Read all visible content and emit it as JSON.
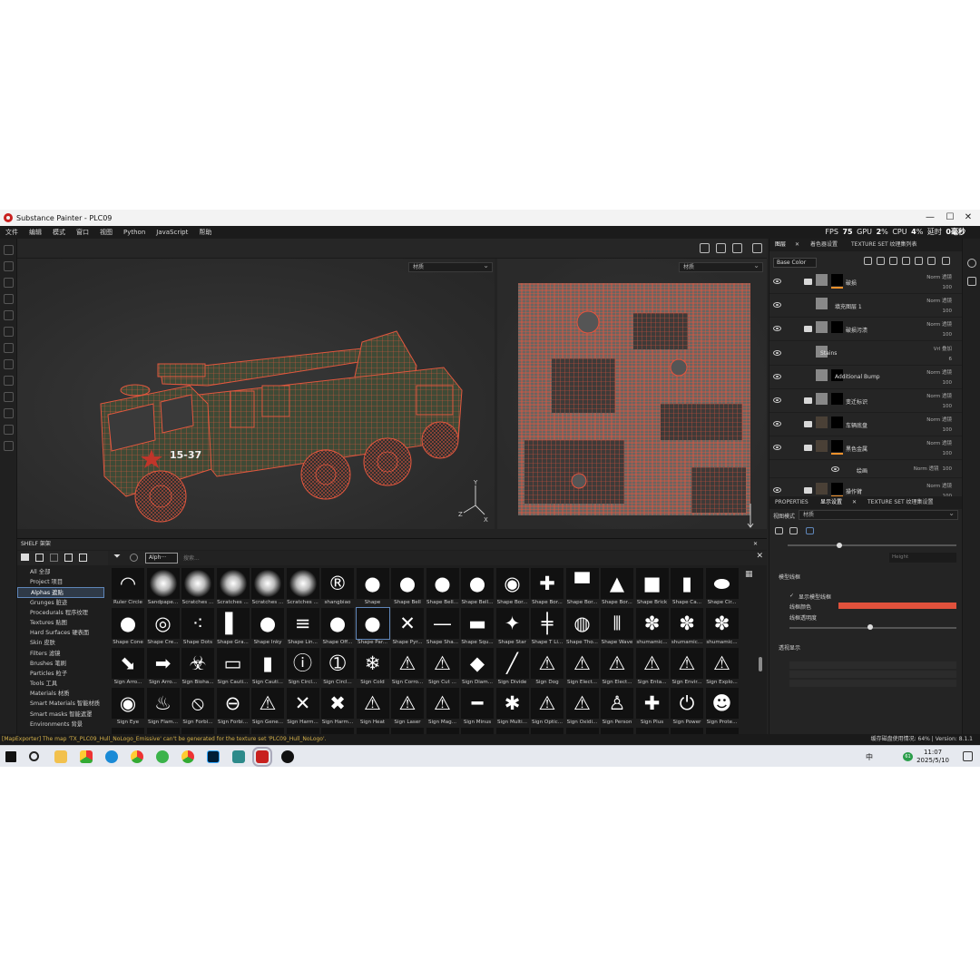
{
  "window": {
    "title": "Substance Painter - PLC09"
  },
  "menu": [
    "文件",
    "编辑",
    "模式",
    "窗口",
    "视图",
    "Python",
    "JavaScript",
    "帮助"
  ],
  "perf": {
    "fps_label": "FPS",
    "fps": "75",
    "gpu_label": "GPU",
    "gpu": "2",
    "cpu_label": "CPU",
    "cpu": "4",
    "latency_label": "延时",
    "latency": "0毫秒"
  },
  "viewport": {
    "mode_left": "材质",
    "mode_right": "材质",
    "unit_label": "15-37"
  },
  "shelf": {
    "title": "SHELF 架架",
    "search_chip": "Alph···",
    "search_placeholder": "搜索...",
    "categories": [
      "All 全部",
      "Project 项目",
      "Alphas 遮贴",
      "Grunges 脏迹",
      "Procedurals 程序纹理",
      "Textures 贴图",
      "Hard Surfaces 硬表面",
      "Skin 皮肤",
      "Filters 滤镜",
      "Brushes 笔刷",
      "Particles 粒子",
      "Tools 工具",
      "Materials 材质",
      "Smart Materials 智能材质",
      "Smart masks 智能遮罩",
      "Environments 背景"
    ],
    "selected_category": 2,
    "rows": [
      [
        "Ruler Circle",
        "Sandpape...",
        "Scratches ...",
        "Scratches ...",
        "Scratches ...",
        "Scratches ...",
        "shangbiao",
        "Shape",
        "Shape Bell",
        "Shape Bell...",
        "Shape Bell...",
        "Shape Bor...",
        "Shape Bor...",
        "Shape Bor...",
        "Shape Bor...",
        "Shape Brick",
        "Shape Ca...",
        "Shape Cir..."
      ],
      [
        "Shape Cone",
        "Shape Cre...",
        "Shape Dots",
        "Shape Gra...",
        "Shape Inky",
        "Shape Lin...",
        "Shape Off...",
        "Shape Par...",
        "Shape Pyr...",
        "Shape Sha...",
        "Shape Squ...",
        "Shape Star",
        "Shape T Li...",
        "Shape Tho...",
        "Shape Wave",
        "shumamic...",
        "shumamic...",
        "shumamic..."
      ],
      [
        "Sign Arro...",
        "Sign Arro...",
        "Sign Bioha...",
        "Sign Cauti...",
        "Sign Cauti...",
        "Sign Circl...",
        "Sign Circl...",
        "Sign Cold",
        "Sign Corro...",
        "Sign Cut ...",
        "Sign Diam...",
        "Sign Divide",
        "Sign Dog",
        "Sign Elect...",
        "Sign Elect...",
        "Sign Enta...",
        "Sign Envir...",
        "Sign Explo..."
      ],
      [
        "Sign Eye",
        "Sign Flam...",
        "Sign Forbi...",
        "Sign Forbi...",
        "Sign Gene...",
        "Sign Harm...",
        "Sign Harm...",
        "Sign Heat",
        "Sign Laser",
        "Sign Mag...",
        "Sign Minus",
        "Sign Multi...",
        "Sign Optic...",
        "Sign Oxidi...",
        "Sign Person",
        "Sign Plus",
        "Sign Power",
        "Sign Prote..."
      ],
      [
        "",
        "",
        "",
        "",
        "",
        "",
        "",
        "",
        "",
        "",
        "",
        "",
        "",
        "",
        "",
        "",
        "",
        ""
      ]
    ],
    "symbols": [
      [
        "◠",
        "",
        "",
        "",
        "",
        "",
        "®",
        "●",
        "●",
        "●",
        "●",
        "◉",
        "✚",
        "▀",
        "▲",
        "■",
        "▮",
        "⬬"
      ],
      [
        "●",
        "◎",
        "⁖",
        "▌",
        "●",
        "≡",
        "●",
        "●",
        "✕",
        "—",
        "▬",
        "✦",
        "╪",
        "◍",
        "⦀",
        "✽",
        "✽",
        "✽"
      ],
      [
        "⬊",
        "➡",
        "☣",
        "▭",
        "▮",
        "ⓘ",
        "➀",
        "❄",
        "⚠",
        "⚠",
        "◆",
        "╱",
        "⚠",
        "⚠",
        "⚠",
        "⚠",
        "⚠",
        "⚠"
      ],
      [
        "◉",
        "♨",
        "⦸",
        "⊖",
        "⚠",
        "✕",
        "✖",
        "⚠",
        "⚠",
        "⚠",
        "━",
        "✱",
        "⚠",
        "⚠",
        "♙",
        "✚",
        "⏻",
        "☻"
      ],
      [
        "▲",
        "▲",
        "◯",
        "▲",
        "▲",
        "⬚",
        "⬚",
        "⬚",
        "⬚",
        "⬚",
        "⬚",
        "⬚",
        "⬚",
        "⬚",
        "⬚",
        "⬚",
        "⬚",
        "⬚"
      ]
    ]
  },
  "right": {
    "tabs": [
      "图层",
      "着色器设置",
      "TEXTURE SET 纹理集列表"
    ],
    "channel": "Base Color",
    "layers": [
      {
        "name": "破损",
        "blend": "Norm 透镜",
        "opacity": "100"
      },
      {
        "name": "填充图层 1",
        "blend": "Norm 透镜",
        "opacity": "100"
      },
      {
        "name": "破损污渍",
        "blend": "Norm 透镜",
        "opacity": "100"
      },
      {
        "name": "Stains",
        "blend": "Vrl 叠加",
        "opacity": "6"
      },
      {
        "name": "Additional Bump",
        "blend": "Norm 透镜",
        "opacity": "100"
      },
      {
        "name": "变迁标识",
        "blend": "Norm 透镜",
        "opacity": "100"
      },
      {
        "name": "车辆底盘",
        "blend": "Norm 透镜",
        "opacity": "100"
      },
      {
        "name": "黑色金属",
        "blend": "Norm 透镜",
        "opacity": "100"
      },
      {
        "name": "绘画",
        "blend": "Norm 透镜",
        "opacity": "100"
      },
      {
        "name": "操作臂",
        "blend": "Norm 透镜",
        "opacity": "100"
      }
    ],
    "props_tabs": [
      "PROPERTIES",
      "显示设置",
      "TEXTURE SET 纹理集设置"
    ],
    "view_mode_label": "视图模式",
    "view_mode": "材质",
    "height_label": "Height",
    "wire_section": "模型线框",
    "show_wire": "显示模型线框",
    "wire_color": "线框颜色",
    "wire_opacity": "线框透明度",
    "transparency": "透视显示",
    "wire_color_hex": "#e0513c"
  },
  "status": {
    "message": "[MapExporter] The map 'TX_PLC09_Hull_NoLogo_Emissive' can't be generated for the texture set 'PLC09_Hull_NoLogo'.",
    "cache_label": "缓存磁盘使用情况:",
    "cache": "64%",
    "version": "Version: 8.1.1"
  },
  "taskbar": {
    "time": "11:07",
    "date": "2025/5/10",
    "ime": "中",
    "badge": "61"
  }
}
